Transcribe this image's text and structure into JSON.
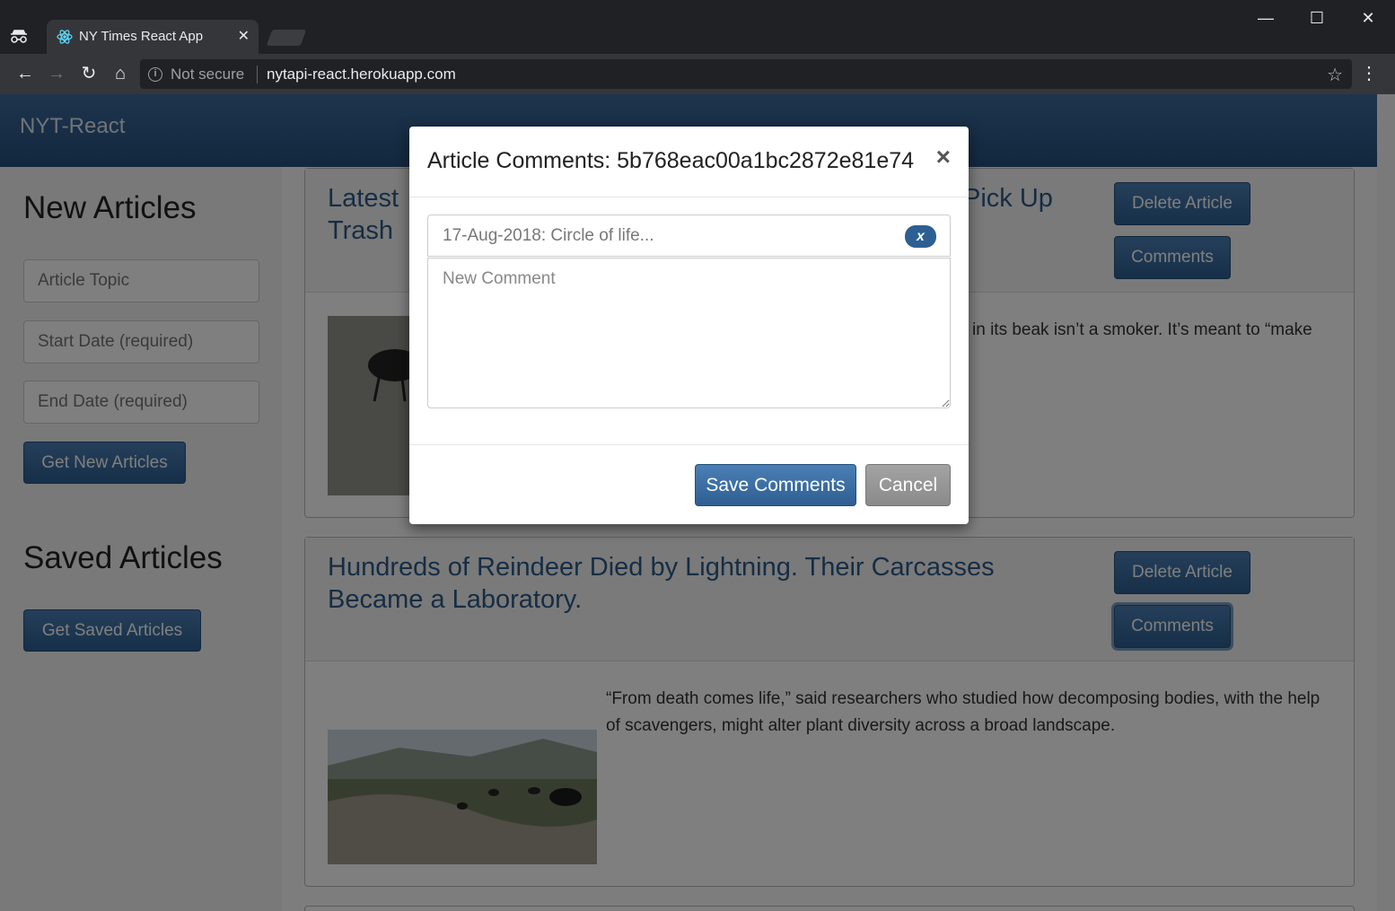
{
  "browser": {
    "tab_title": "NY Times React App",
    "security_label": "Not secure",
    "url": "nytapi-react.herokuapp.com"
  },
  "app": {
    "brand": "NYT-React"
  },
  "sidebar": {
    "new_heading": "New Articles",
    "topic_placeholder": "Article Topic",
    "start_placeholder": "Start Date (required)",
    "end_placeholder": "End Date (required)",
    "get_new_label": "Get New Articles",
    "saved_heading": "Saved Articles",
    "get_saved_label": "Get Saved Articles"
  },
  "articles": [
    {
      "title_left": "Latest",
      "title_left_line2": "Trash",
      "title_right": "Pick Up",
      "snippet": "in its beak isn’t a smoker. It’s meant to “make",
      "delete_label": "Delete Article",
      "comments_label": "Comments"
    },
    {
      "title": "Hundreds of Reindeer Died by Lightning. Their Carcasses Became a Laboratory.",
      "snippet": "“From death comes life,” said researchers who studied how decomposing bodies, with the help of scavengers, might alter plant diversity across a broad landscape.",
      "delete_label": "Delete Article",
      "comments_label": "Comments"
    }
  ],
  "modal": {
    "title": "Article Comments: 5b768eac00a1bc2872e81e74",
    "close_glyph": "×",
    "comments": [
      {
        "text": "17-Aug-2018: Circle of life...",
        "delete_glyph": "x"
      }
    ],
    "new_comment_placeholder": "New Comment",
    "save_label": "Save Comments",
    "cancel_label": "Cancel"
  }
}
